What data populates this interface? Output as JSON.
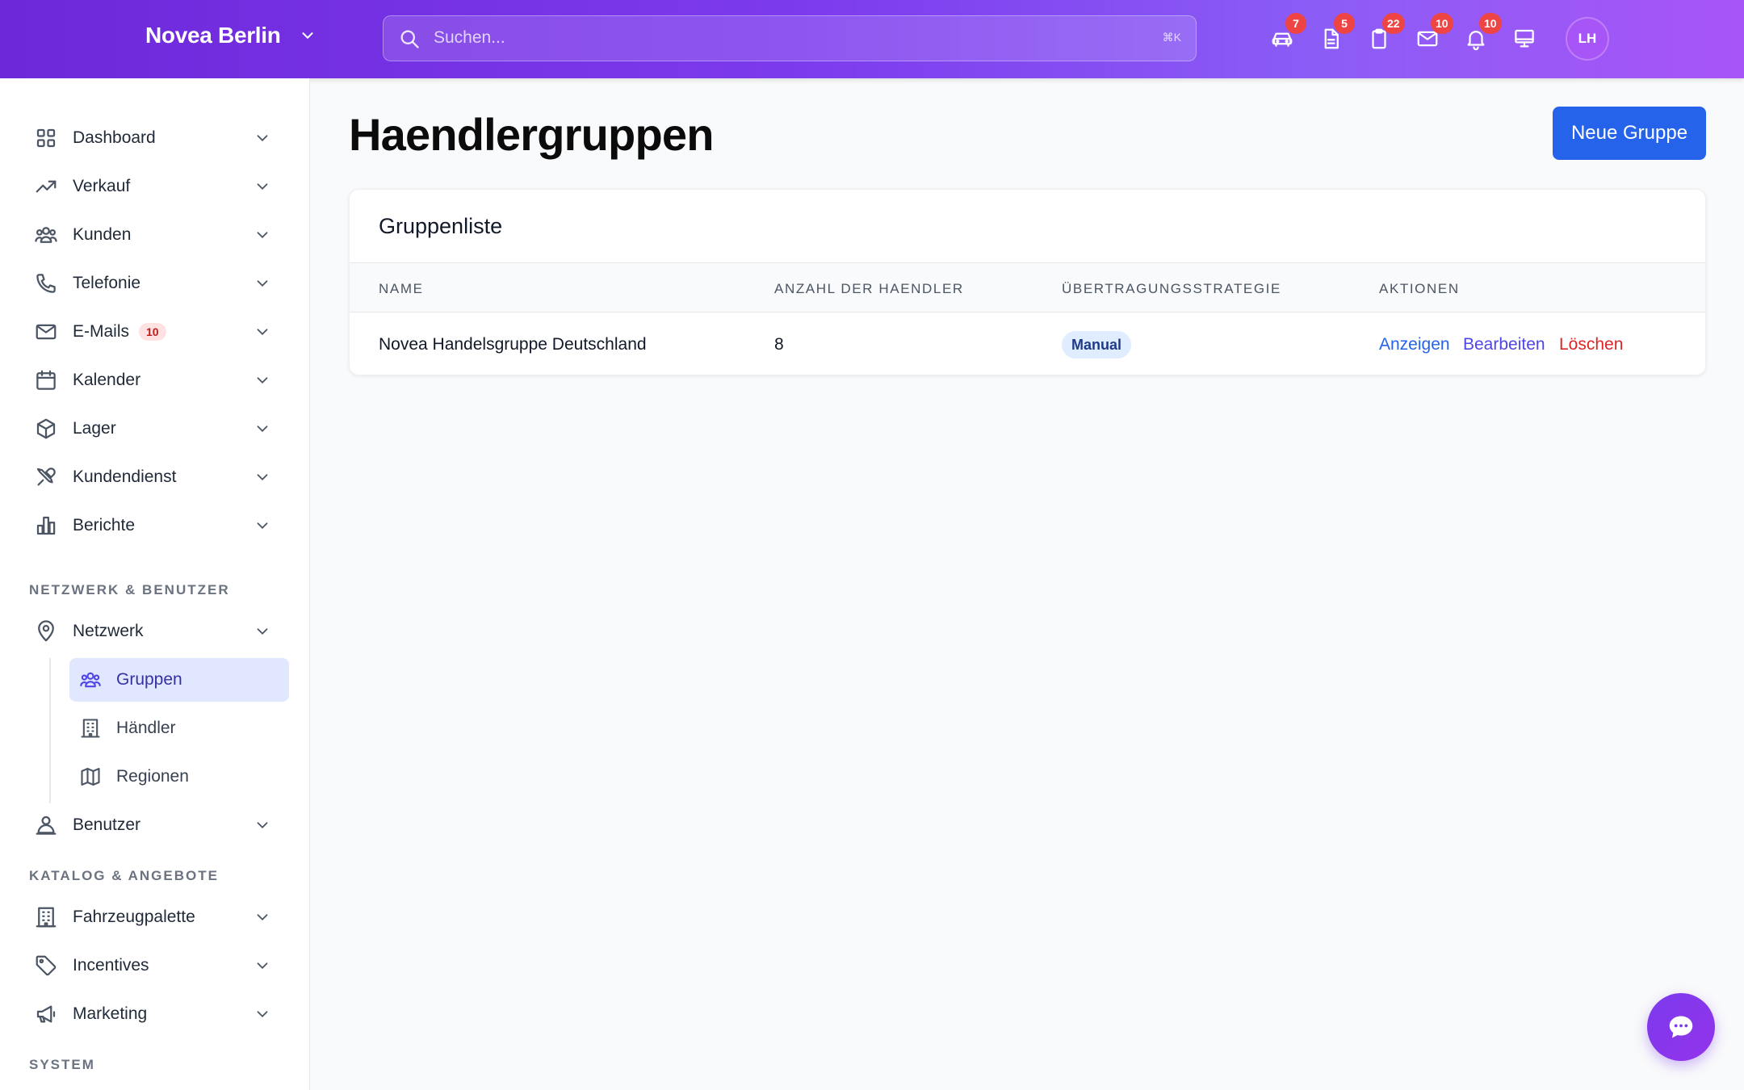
{
  "header": {
    "brand": "Novea Berlin",
    "search_placeholder": "Suchen...",
    "search_shortcut": "⌘K",
    "icons": [
      {
        "name": "car-icon",
        "badge": "7"
      },
      {
        "name": "document-icon",
        "badge": "5"
      },
      {
        "name": "clipboard-icon",
        "badge": "22"
      },
      {
        "name": "mail-icon",
        "badge": "10"
      },
      {
        "name": "bell-icon",
        "badge": "10"
      },
      {
        "name": "monitor-icon",
        "badge": ""
      }
    ],
    "avatar_initials": "LH"
  },
  "sidebar": {
    "items": [
      {
        "label": "Dashboard",
        "icon": "grid-icon"
      },
      {
        "label": "Verkauf",
        "icon": "trending-up-icon"
      },
      {
        "label": "Kunden",
        "icon": "users-icon"
      },
      {
        "label": "Telefonie",
        "icon": "phone-icon"
      },
      {
        "label": "E-Mails",
        "icon": "mail-icon",
        "badge": "10"
      },
      {
        "label": "Kalender",
        "icon": "calendar-icon"
      },
      {
        "label": "Lager",
        "icon": "box-icon"
      },
      {
        "label": "Kundendienst",
        "icon": "tools-icon"
      },
      {
        "label": "Berichte",
        "icon": "bar-chart-icon"
      }
    ],
    "section_network": "NETZWERK & BENUTZER",
    "network": {
      "label": "Netzwerk",
      "icon": "map-pin-icon"
    },
    "network_sub": [
      {
        "label": "Gruppen",
        "icon": "users-icon",
        "active": true
      },
      {
        "label": "Händler",
        "icon": "building-icon"
      },
      {
        "label": "Regionen",
        "icon": "map-icon"
      }
    ],
    "users": {
      "label": "Benutzer",
      "icon": "user-icon"
    },
    "section_catalog": "KATALOG & ANGEBOTE",
    "catalog": [
      {
        "label": "Fahrzeugpalette",
        "icon": "building-icon"
      },
      {
        "label": "Incentives",
        "icon": "tag-icon"
      },
      {
        "label": "Marketing",
        "icon": "megaphone-icon"
      }
    ],
    "section_system": "SYSTEM"
  },
  "main": {
    "title": "Haendlergruppen",
    "new_button": "Neue Gruppe",
    "card_title": "Gruppenliste",
    "columns": [
      "NAME",
      "ANZAHL DER HAENDLER",
      "ÜBERTRAGUNGSSTRATEGIE",
      "AKTIONEN"
    ],
    "rows": [
      {
        "name": "Novea Handelsgruppe Deutschland",
        "count": "8",
        "strategy": "Manual",
        "actions": {
          "view": "Anzeigen",
          "edit": "Bearbeiten",
          "delete": "Löschen"
        }
      }
    ]
  },
  "colors": {
    "header_gradient_start": "#6d28d9",
    "header_gradient_end": "#a855f7",
    "primary": "#2563eb",
    "view_link": "#2563eb",
    "edit_link": "#4f46e5",
    "delete_link": "#dc2626",
    "active_nav_bg": "#e0e7ff"
  }
}
